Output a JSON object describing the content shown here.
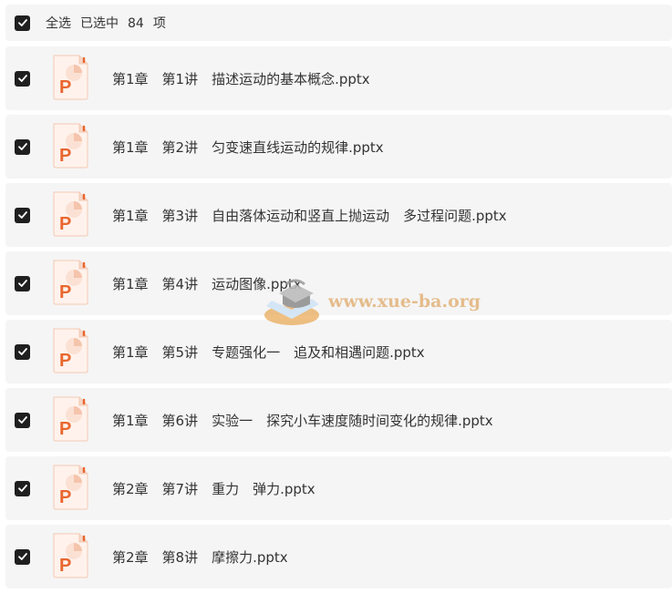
{
  "header": {
    "select_all": "全选",
    "selected_prefix": "已选中",
    "selected_count": "84",
    "selected_suffix": "项"
  },
  "files": [
    {
      "name": "第1章　第1讲　描述运动的基本概念.pptx",
      "checked": true,
      "icon": "powerpoint-file-icon"
    },
    {
      "name": "第1章　第2讲　匀变速直线运动的规律.pptx",
      "checked": true,
      "icon": "powerpoint-file-icon"
    },
    {
      "name": "第1章　第3讲　自由落体运动和竖直上抛运动　多过程问题.pptx",
      "checked": true,
      "icon": "powerpoint-file-icon"
    },
    {
      "name": "第1章　第4讲　运动图像.pptx",
      "checked": true,
      "icon": "powerpoint-file-icon"
    },
    {
      "name": "第1章　第5讲　专题强化一　追及和相遇问题.pptx",
      "checked": true,
      "icon": "powerpoint-file-icon"
    },
    {
      "name": "第1章　第6讲　实验一　探究小车速度随时间变化的规律.pptx",
      "checked": true,
      "icon": "powerpoint-file-icon"
    },
    {
      "name": "第2章　第7讲　重力　弹力.pptx",
      "checked": true,
      "icon": "powerpoint-file-icon"
    },
    {
      "name": "第2章　第8讲　摩擦力.pptx",
      "checked": true,
      "icon": "powerpoint-file-icon"
    }
  ],
  "watermark": {
    "text": "www.xue-ba.org"
  },
  "colors": {
    "row_bg": "#f5f5f5",
    "checkbox": "#1f1f1f",
    "ppt_orange": "#e8672f"
  }
}
